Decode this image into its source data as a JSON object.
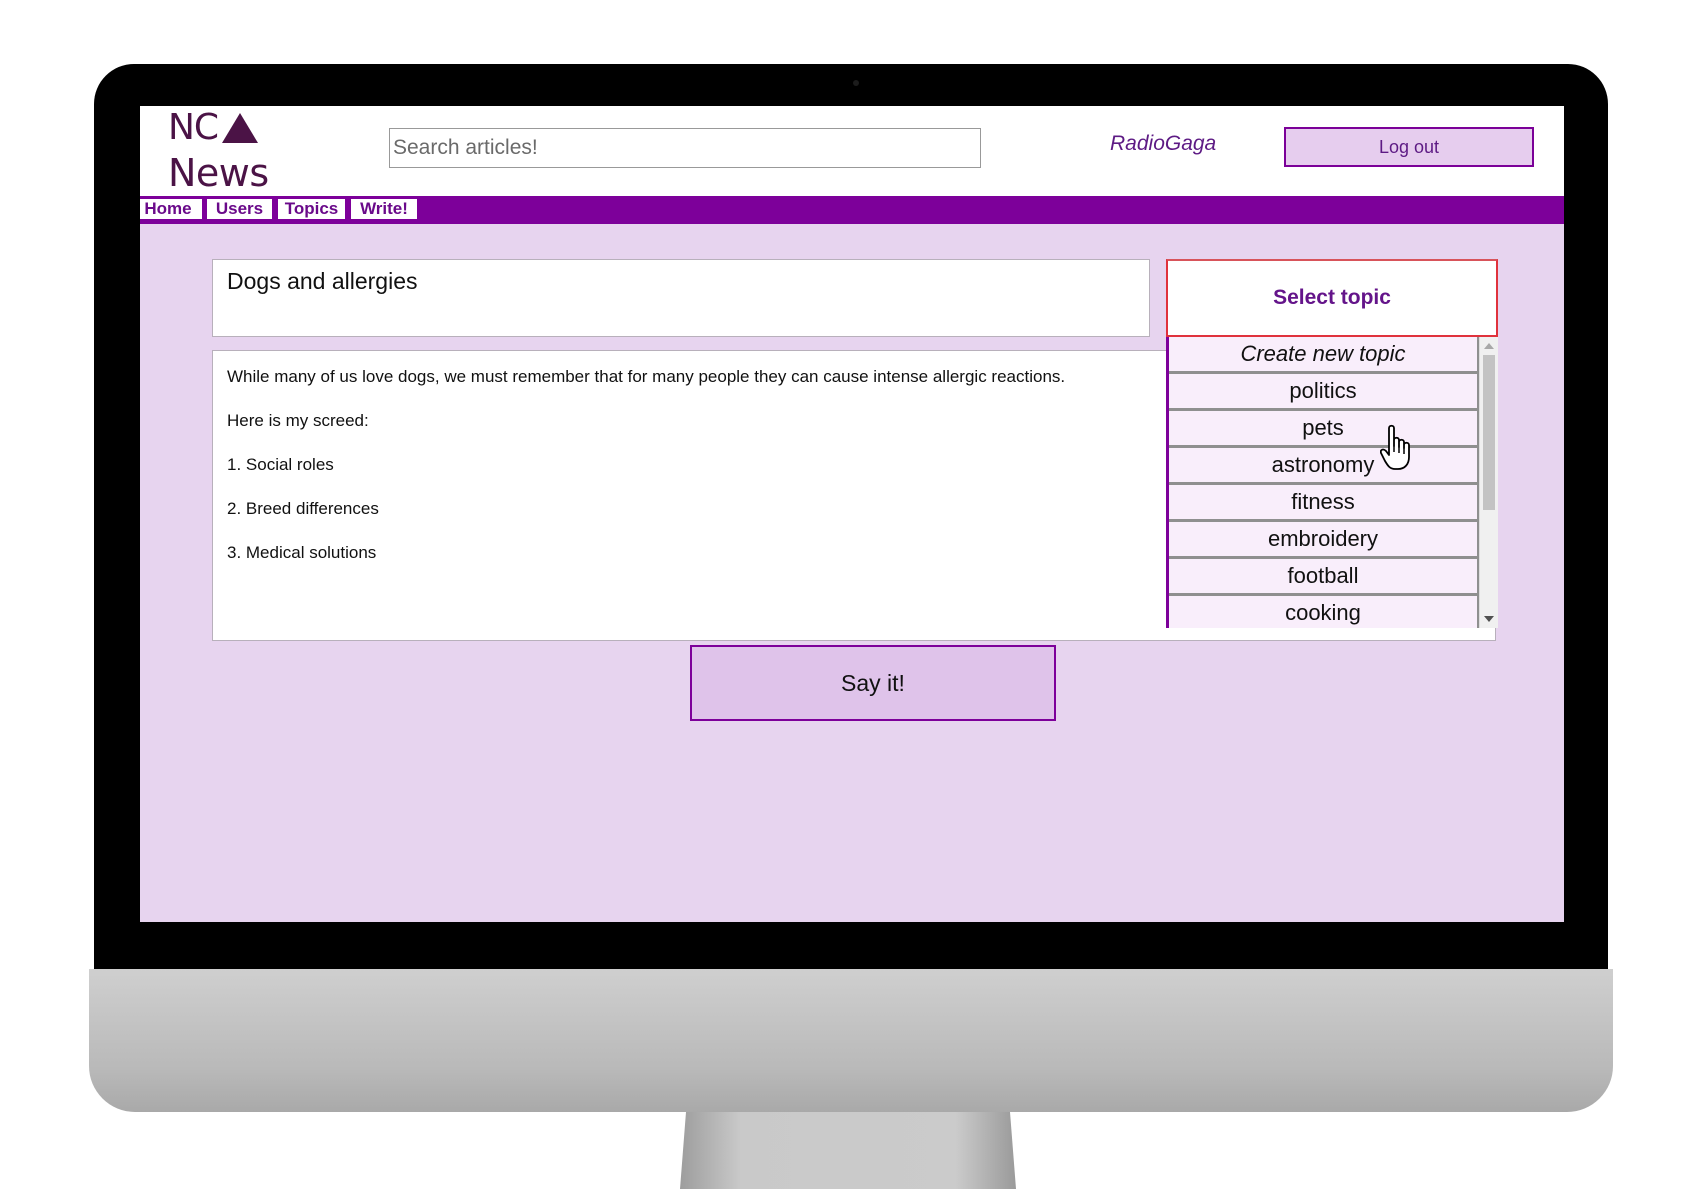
{
  "header": {
    "logo_line1": "NC",
    "logo_line2": "News",
    "search_placeholder": "Search articles!",
    "username": "RadioGaga",
    "logout_label": "Log out"
  },
  "nav": {
    "items": [
      "Home",
      "Users",
      "Topics",
      "Write!"
    ]
  },
  "form": {
    "title_value": "Dogs and allergies",
    "body_paragraphs": [
      "While many of us love dogs, we must remember that for many people they can cause intense allergic reactions.",
      "Here is my screed:",
      "1. Social roles",
      "2. Breed differences",
      "3. Medical solutions"
    ],
    "topic_select_label": "Select topic",
    "topic_options": [
      "Create new topic",
      "politics",
      "pets",
      "astronomy",
      "fitness",
      "embroidery",
      "football",
      "cooking"
    ],
    "submit_label": "Say it!"
  },
  "colors": {
    "accent": "#7d009a",
    "background": "#e7d4ef",
    "brand": "#4b1346"
  },
  "icons": {
    "logo": "triangle-logo-icon",
    "cursor": "hand-pointer-icon"
  }
}
